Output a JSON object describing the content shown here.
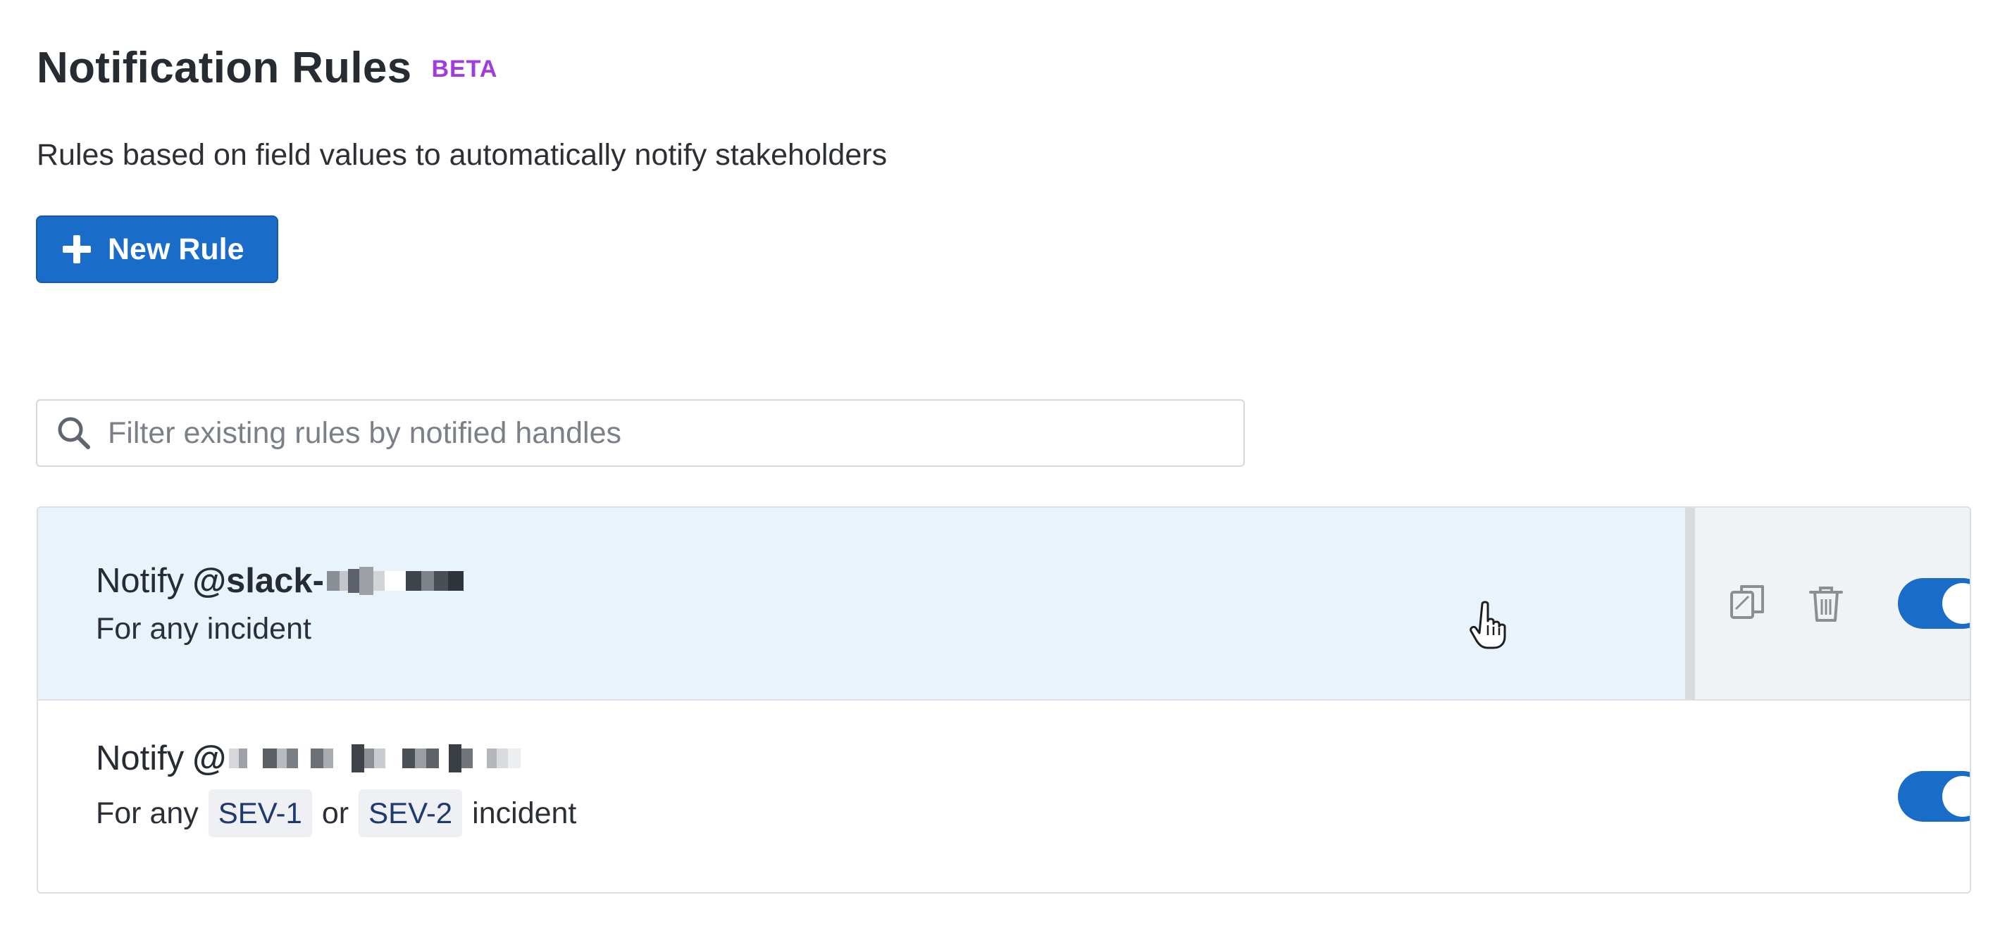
{
  "header": {
    "title": "Notification Rules",
    "badge": "BETA",
    "subtitle": "Rules based on field values to automatically notify stakeholders"
  },
  "toolbar": {
    "new_rule_label": "New Rule"
  },
  "search": {
    "placeholder": "Filter existing rules by notified handles",
    "value": ""
  },
  "rules": [
    {
      "prefix": "Notify",
      "handle": "@slack-",
      "condition_text": "For any incident",
      "enabled": true,
      "hovered": true
    },
    {
      "prefix": "Notify",
      "handle": "@",
      "condition_prefix": "For any",
      "tags": [
        "SEV-1",
        "SEV-2"
      ],
      "conjunction": "or",
      "condition_suffix": "incident",
      "enabled": true
    }
  ],
  "icons": {
    "add": "plus-icon",
    "search": "search-icon",
    "duplicate": "copy-icon",
    "delete": "trash-icon",
    "cursor": "hand-pointer-icon"
  },
  "colors": {
    "primary": "#1a6cc9",
    "beta": "#a03be0",
    "hover_row": "#e8f3fb",
    "tag_bg": "#eef0f4",
    "tag_text": "#1e3a6e"
  }
}
